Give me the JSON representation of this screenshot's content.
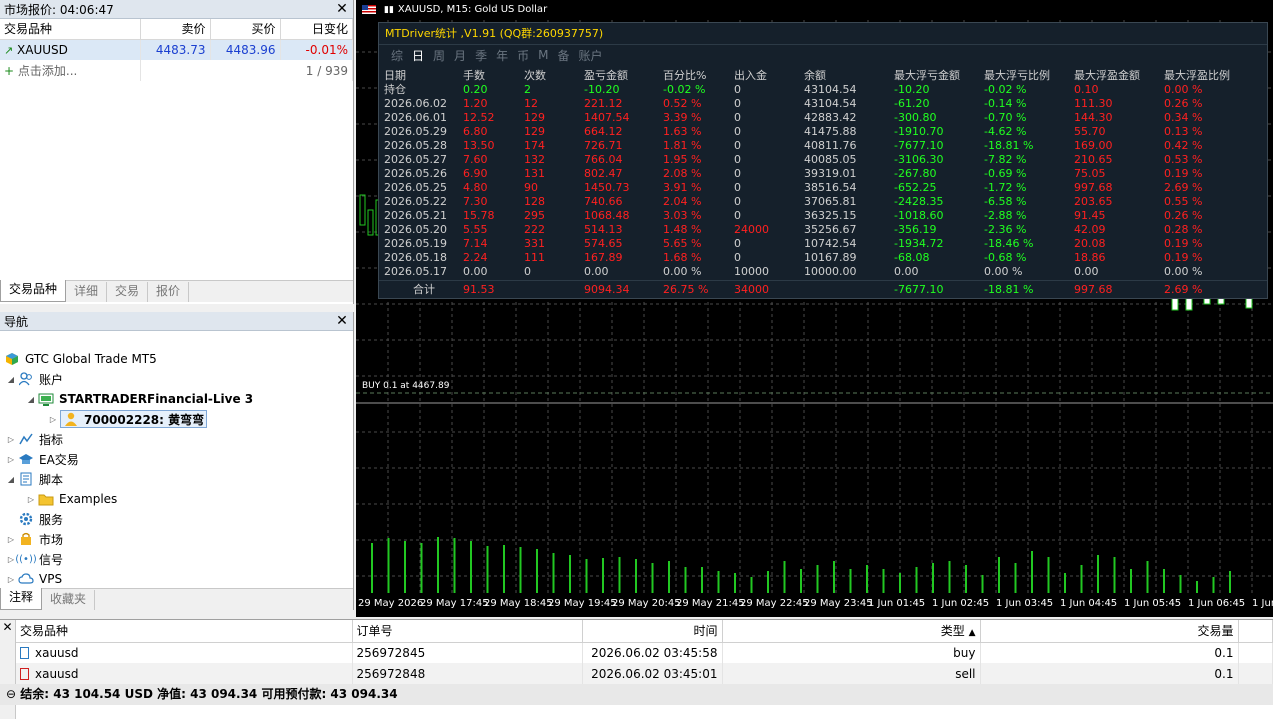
{
  "market_watch": {
    "title": "市场报价: 04:06:47",
    "cols": [
      "交易品种",
      "卖价",
      "买价",
      "日变化"
    ],
    "row": {
      "symbol": "XAUUSD",
      "bid": "4483.73",
      "ask": "4483.96",
      "change": "-0.01%"
    },
    "add": "点击添加...",
    "count": "1 / 939",
    "tabs": [
      "交易品种",
      "详细",
      "交易",
      "报价"
    ]
  },
  "navigator": {
    "title": "导航",
    "root": "GTC Global Trade MT5",
    "accounts": "账户",
    "server": "STARTRADERFinancial-Live 3",
    "account": "700002228: 黄弯弯",
    "indicators": "指标",
    "ea": "EA交易",
    "scripts": "脚本",
    "examples": "Examples",
    "services": "服务",
    "market": "市场",
    "signals": "信号",
    "vps": "VPS",
    "tabs": [
      "注释",
      "收藏夹"
    ]
  },
  "chart": {
    "title": "XAUUSD, M15:  Gold US Dollar",
    "buy_line": "BUY 0.1 at 4467.89",
    "times": [
      "29 May 2026",
      "29 May 17:45",
      "29 May 18:45",
      "29 May 19:45",
      "29 May 20:45",
      "29 May 21:45",
      "29 May 22:45",
      "29 May 23:45",
      "1 Jun 01:45",
      "1 Jun 02:45",
      "1 Jun 03:45",
      "1 Jun 04:45",
      "1 Jun 05:45",
      "1 Jun 06:45",
      "1 Jun"
    ],
    "volume_bars": [
      50,
      55,
      52,
      50,
      56,
      55,
      52,
      47,
      48,
      46,
      44,
      40,
      38,
      34,
      35,
      36,
      34,
      30,
      32,
      26,
      26,
      22,
      20,
      16,
      22,
      32,
      24,
      28,
      32,
      24,
      28,
      24,
      20,
      26,
      30,
      32,
      28,
      18,
      36,
      30,
      42,
      36,
      20,
      28,
      38,
      36,
      24,
      32,
      24,
      18,
      12,
      16,
      22
    ]
  },
  "stats": {
    "header": "MTDriver统计 ,V1.91 (QQ群:260937757)",
    "tabs": [
      "综",
      "日",
      "周",
      "月",
      "季",
      "年",
      "币",
      "M",
      "备",
      "账户"
    ],
    "cols": [
      "日期",
      "手数",
      "次数",
      "盈亏金额",
      "百分比%",
      "出入金",
      "余额",
      "最大浮亏金额",
      "最大浮亏比例",
      "最大浮盈金额",
      "最大浮盈比例"
    ],
    "rows": [
      [
        "持仓",
        "0.20",
        "2",
        "-10.20",
        "-0.02 %",
        "0",
        "43104.54",
        "-10.20",
        "-0.02 %",
        "0.10",
        "0.00 %"
      ],
      [
        "2026.06.02",
        "1.20",
        "12",
        "221.12",
        "0.52 %",
        "0",
        "43104.54",
        "-61.20",
        "-0.14 %",
        "111.30",
        "0.26 %"
      ],
      [
        "2026.06.01",
        "12.52",
        "129",
        "1407.54",
        "3.39 %",
        "0",
        "42883.42",
        "-300.80",
        "-0.70 %",
        "144.30",
        "0.34 %"
      ],
      [
        "2026.05.29",
        "6.80",
        "129",
        "664.12",
        "1.63 %",
        "0",
        "41475.88",
        "-1910.70",
        "-4.62 %",
        "55.70",
        "0.13 %"
      ],
      [
        "2026.05.28",
        "13.50",
        "174",
        "726.71",
        "1.81 %",
        "0",
        "40811.76",
        "-7677.10",
        "-18.81 %",
        "169.00",
        "0.42 %"
      ],
      [
        "2026.05.27",
        "7.60",
        "132",
        "766.04",
        "1.95 %",
        "0",
        "40085.05",
        "-3106.30",
        "-7.82 %",
        "210.65",
        "0.53 %"
      ],
      [
        "2026.05.26",
        "6.90",
        "131",
        "802.47",
        "2.08 %",
        "0",
        "39319.01",
        "-267.80",
        "-0.69 %",
        "75.05",
        "0.19 %"
      ],
      [
        "2026.05.25",
        "4.80",
        "90",
        "1450.73",
        "3.91 %",
        "0",
        "38516.54",
        "-652.25",
        "-1.72 %",
        "997.68",
        "2.69 %"
      ],
      [
        "2026.05.22",
        "7.30",
        "128",
        "740.66",
        "2.04 %",
        "0",
        "37065.81",
        "-2428.35",
        "-6.58 %",
        "203.65",
        "0.55 %"
      ],
      [
        "2026.05.21",
        "15.78",
        "295",
        "1068.48",
        "3.03 %",
        "0",
        "36325.15",
        "-1018.60",
        "-2.88 %",
        "91.45",
        "0.26 %"
      ],
      [
        "2026.05.20",
        "5.55",
        "222",
        "514.13",
        "1.48 %",
        "24000",
        "35256.67",
        "-356.19",
        "-2.36 %",
        "42.09",
        "0.28 %"
      ],
      [
        "2026.05.19",
        "7.14",
        "331",
        "574.65",
        "5.65 %",
        "0",
        "10742.54",
        "-1934.72",
        "-18.46 %",
        "20.08",
        "0.19 %"
      ],
      [
        "2026.05.18",
        "2.24",
        "111",
        "167.89",
        "1.68 %",
        "0",
        "10167.89",
        "-68.08",
        "-0.68 %",
        "18.86",
        "0.19 %"
      ],
      [
        "2026.05.17",
        "0.00",
        "0",
        "0.00",
        "0.00 %",
        "10000",
        "10000.00",
        "0.00",
        "0.00 %",
        "0.00",
        "0.00 %"
      ]
    ],
    "total": [
      "合计",
      "91.53",
      "",
      "9094.34",
      "26.75 %",
      "34000",
      "",
      "-7677.10",
      "-18.81 %",
      "997.68",
      "2.69 %"
    ]
  },
  "toolbox": {
    "cols": [
      "交易品种",
      "订单号",
      "时间",
      "类型",
      "交易量"
    ],
    "rows": [
      [
        "xauusd",
        "256972845",
        "2026.06.02 03:45:58",
        "buy",
        "0.1"
      ],
      [
        "xauusd",
        "256972848",
        "2026.06.02 03:45:01",
        "sell",
        "0.1"
      ]
    ],
    "balance": "结余: 43 104.54 USD  净值: 43 094.34  可用预付款: 43 094.34"
  }
}
